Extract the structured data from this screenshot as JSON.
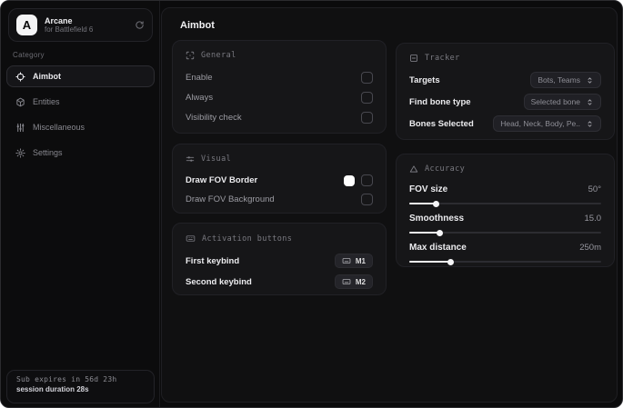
{
  "brand": {
    "logo_letter": "A",
    "name": "Arcane",
    "subtitle": "for Battlefield 6"
  },
  "sidebar": {
    "category_label": "Category",
    "items": [
      {
        "label": "Aimbot",
        "icon": "crosshair-icon",
        "selected": true
      },
      {
        "label": "Entities",
        "icon": "cube-icon",
        "selected": false
      },
      {
        "label": "Miscellaneous",
        "icon": "vertical-sliders-icon",
        "selected": false
      },
      {
        "label": "Settings",
        "icon": "gear-icon",
        "selected": false
      }
    ],
    "status_line1": "Sub expires in 56d 23h",
    "status_line2": "session duration 28s"
  },
  "main": {
    "title": "Aimbot",
    "general": {
      "header": "General",
      "rows": [
        {
          "label": "Enable",
          "checked": false
        },
        {
          "label": "Always",
          "checked": false
        },
        {
          "label": "Visibility check",
          "checked": false
        }
      ]
    },
    "visual": {
      "header": "Visual",
      "rows": [
        {
          "label": "Draw FOV Border",
          "swatch_color": "#ffffff",
          "checked": false
        },
        {
          "label": "Draw FOV Background",
          "checked": false
        }
      ]
    },
    "activation": {
      "header": "Activation buttons",
      "rows": [
        {
          "label": "First keybind",
          "key": "M1"
        },
        {
          "label": "Second keybind",
          "key": "M2"
        }
      ]
    },
    "tracker": {
      "header": "Tracker",
      "rows": [
        {
          "label": "Targets",
          "value": "Bots, Teams"
        },
        {
          "label": "Find bone type",
          "value": "Selected bone"
        },
        {
          "label": "Bones Selected",
          "value": "Head, Neck, Body, Pe.."
        }
      ]
    },
    "accuracy": {
      "header": "Accuracy",
      "sliders": [
        {
          "label": "FOV size",
          "value": "50°",
          "percent": 14
        },
        {
          "label": "Smoothness",
          "value": "15.0",
          "percent": 16
        },
        {
          "label": "Max distance",
          "value": "250m",
          "percent": 22
        }
      ]
    }
  },
  "colors": {
    "accent": "#f2f2f4",
    "fov_border_swatch": "#ffffff"
  }
}
